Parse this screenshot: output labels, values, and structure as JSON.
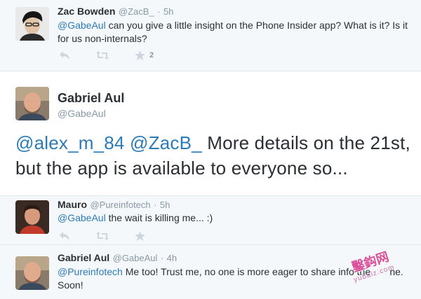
{
  "tweets": [
    {
      "name": "Zac Bowden",
      "handle": "@ZacB_",
      "separator": "·",
      "time": "5h",
      "mention": "@GabeAul",
      "text": " can you give a little insight on the Phone Insider app? What is it? Is it for us non-internals?",
      "favorite_count": "2"
    },
    {
      "name": "Mauro",
      "handle": "@Pureinfotech",
      "separator": "·",
      "time": "5h",
      "mention": "@GabeAul",
      "text": " the wait is killing me... :)"
    },
    {
      "name": "Gabriel Aul",
      "handle": "@GabeAul",
      "separator": "·",
      "time": "4h",
      "mention": "@Pureinfotech",
      "text": " Me too! Trust me, no one is more eager to share info the",
      "text_cont": "ne.",
      "line2": "Soon!"
    }
  ],
  "main_tweet": {
    "name": "Gabriel Aul",
    "handle": "@GabeAul",
    "mention1": "@alex_m_84",
    "mention2": "@ZacB_",
    "text": " More details on the 21st, but the app is available to everyone so..."
  },
  "watermark": {
    "text": "鑿鈎网",
    "url": "yubaiz.com"
  },
  "icons": [
    "reply-icon",
    "retweet-icon",
    "favorite-icon"
  ],
  "colors": {
    "link": "#2b7bb9",
    "icon": "#ccd6dd",
    "muted": "#8899a6",
    "text": "#292f33"
  }
}
